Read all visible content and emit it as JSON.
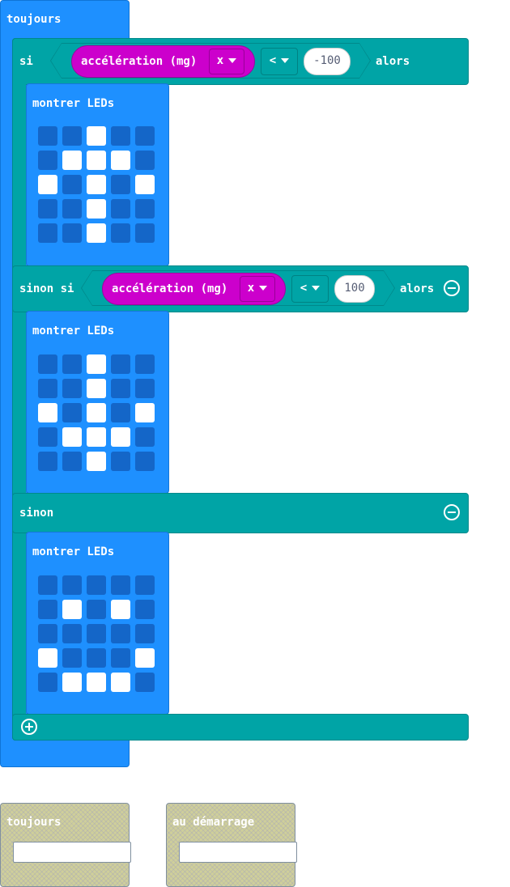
{
  "colors": {
    "loop_blue": "#1e90ff",
    "logic_teal": "#00a4a6",
    "input_magenta": "#cc00cc",
    "led_off": "#1466c8",
    "led_on": "#ffffff",
    "disabled_block": "#cfcf9a"
  },
  "forever": {
    "label": "toujours"
  },
  "if_block": {
    "if_label": "si",
    "then_label": "alors",
    "sensor": "accélération (mg)",
    "axis": "x",
    "operator": "<",
    "value": "-100",
    "leds_label": "montrer LEDs",
    "leds": [
      [
        0,
        0,
        1,
        0,
        0
      ],
      [
        0,
        1,
        1,
        1,
        0
      ],
      [
        1,
        0,
        1,
        0,
        1
      ],
      [
        0,
        0,
        1,
        0,
        0
      ],
      [
        0,
        0,
        1,
        0,
        0
      ]
    ]
  },
  "elseif_block": {
    "label": "sinon si",
    "then_label": "alors",
    "sensor": "accélération (mg)",
    "axis": "x",
    "operator": "<",
    "value": "100",
    "leds_label": "montrer LEDs",
    "leds": [
      [
        0,
        0,
        1,
        0,
        0
      ],
      [
        0,
        0,
        1,
        0,
        0
      ],
      [
        1,
        0,
        1,
        0,
        1
      ],
      [
        0,
        1,
        1,
        1,
        0
      ],
      [
        0,
        0,
        1,
        0,
        0
      ]
    ]
  },
  "else_block": {
    "label": "sinon",
    "leds_label": "montrer LEDs",
    "leds": [
      [
        0,
        0,
        0,
        0,
        0
      ],
      [
        0,
        1,
        0,
        1,
        0
      ],
      [
        0,
        0,
        0,
        0,
        0
      ],
      [
        1,
        0,
        0,
        0,
        1
      ],
      [
        0,
        1,
        1,
        1,
        0
      ]
    ]
  },
  "disabled_blocks": [
    {
      "label": "toujours"
    },
    {
      "label": "au démarrage"
    }
  ]
}
